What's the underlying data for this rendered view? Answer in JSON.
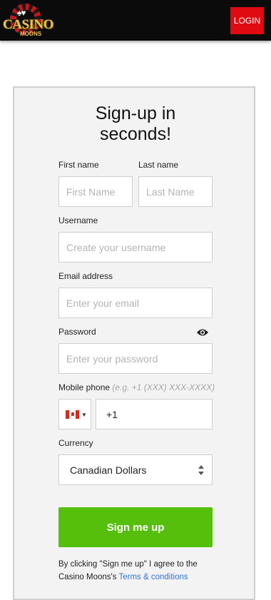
{
  "header": {
    "logo_text": "CASINO",
    "logo_sub": "MOONS",
    "login_label": "LOGIN"
  },
  "form": {
    "title_line1": "Sign-up in",
    "title_line2": "seconds!",
    "first_name": {
      "label": "First name",
      "placeholder": "First Name"
    },
    "last_name": {
      "label": "Last name",
      "placeholder": "Last Name"
    },
    "username": {
      "label": "Username",
      "placeholder": "Create your username"
    },
    "email": {
      "label": "Email address",
      "placeholder": "Enter your email"
    },
    "password": {
      "label": "Password",
      "placeholder": "Enter your password"
    },
    "phone": {
      "label": "Mobile phone",
      "hint": "(e.g. +1 (XXX) XXX-XXXX)",
      "value": "+1",
      "country_flag": "canada-flag-icon"
    },
    "currency": {
      "label": "Currency",
      "selected": "Canadian Dollars"
    },
    "submit_label": "Sign me up",
    "terms_text": "By clicking \"Sign me up\" I agree to the Casino Moons's",
    "terms_link": "Terms & conditions"
  },
  "colors": {
    "header_bg": "#0b0b0b",
    "login_bg": "#e00a12",
    "submit_bg": "#55bf0b",
    "link": "#2f74c9"
  }
}
